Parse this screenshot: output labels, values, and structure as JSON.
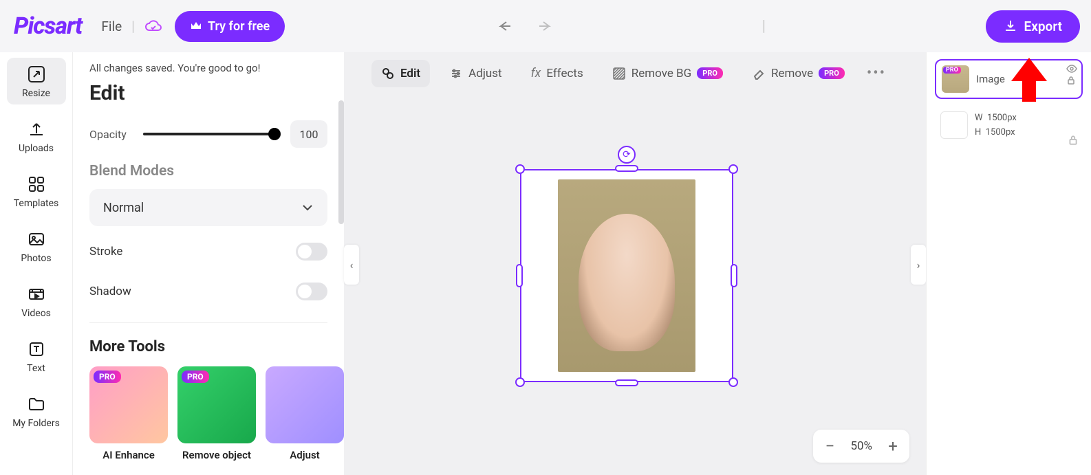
{
  "brand": "Picsart",
  "topbar": {
    "file": "File",
    "try_free": "Try for free",
    "export": "Export"
  },
  "nav": {
    "resize": "Resize",
    "uploads": "Uploads",
    "templates": "Templates",
    "photos": "Photos",
    "videos": "Videos",
    "text": "Text",
    "my_folders": "My Folders"
  },
  "panel": {
    "saved_msg": "All changes saved. You're good to go!",
    "title": "Edit",
    "opacity_label": "Opacity",
    "opacity_value": "100",
    "blend_title": "Blend Modes",
    "blend_value": "Normal",
    "stroke_label": "Stroke",
    "shadow_label": "Shadow",
    "more_title": "More Tools",
    "tools": {
      "ai_enhance": "AI Enhance",
      "remove_object": "Remove object",
      "adjust": "Adjust"
    },
    "pro": "PRO"
  },
  "ctx": {
    "edit": "Edit",
    "adjust": "Adjust",
    "effects": "Effects",
    "remove_bg": "Remove BG",
    "remove": "Remove",
    "pro": "PRO"
  },
  "zoom": {
    "value": "50%"
  },
  "layers": {
    "image_name": "Image",
    "pro": "PRO",
    "w_label": "W",
    "w_value": "1500px",
    "h_label": "H",
    "h_value": "1500px"
  }
}
